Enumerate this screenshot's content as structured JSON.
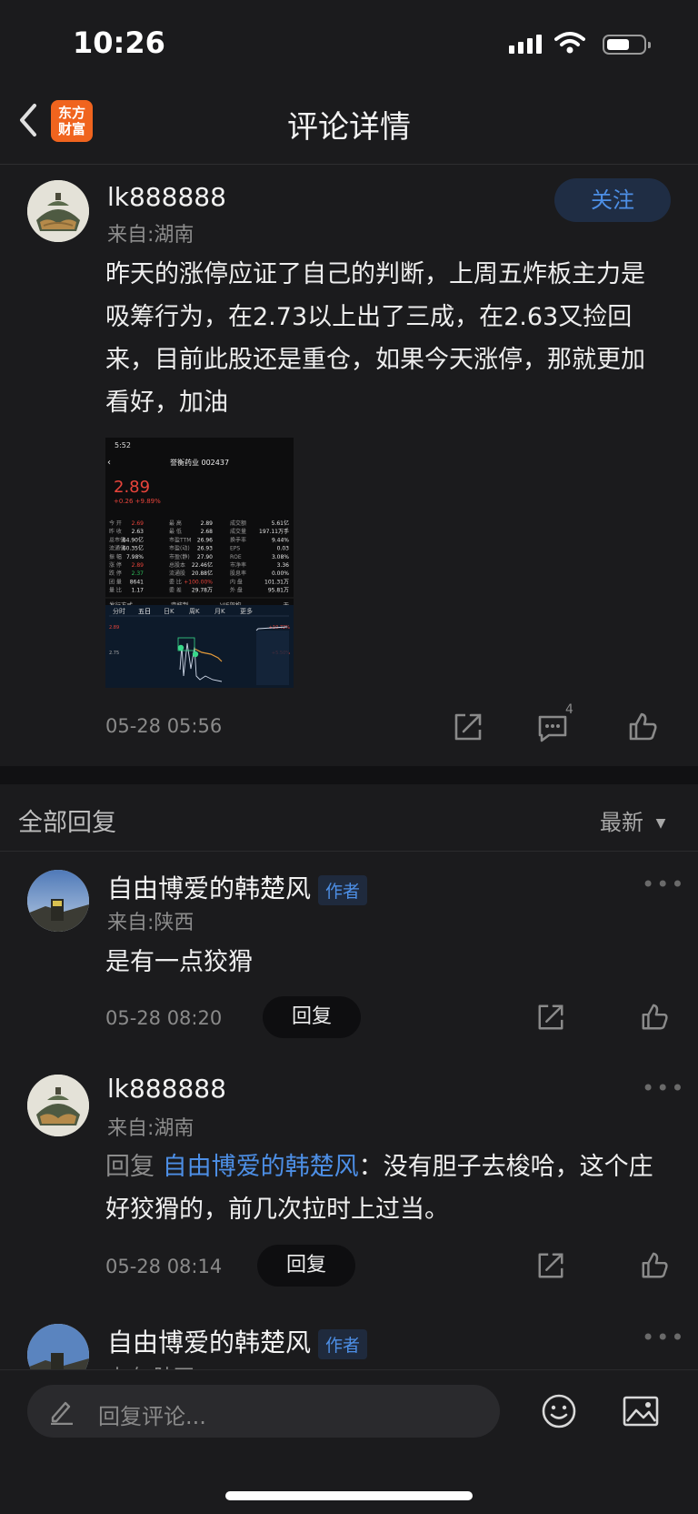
{
  "status": {
    "time": "10:26"
  },
  "header": {
    "title": "评论详情",
    "logo_line1": "东方",
    "logo_line2": "财富"
  },
  "post": {
    "username": "lk888888",
    "location": "来自:湖南",
    "follow_label": "关注",
    "text": "昨天的涨停应证了自己的判断，上周五炸板主力是吸筹行为，在2.73以上出了三成，在2.63又捡回来，目前此股还是重仓，如果今天涨停，那就更加看好，加油",
    "timestamp": "05-28 05:56",
    "comment_count": "4",
    "screenshot": {
      "time": "5:52",
      "stock_name": "誉衡药业 002437",
      "price": "2.89",
      "change": "+0.26 +9.89%",
      "rows": [
        [
          "今 开",
          "2.69",
          "最 高",
          "2.89",
          "成交额",
          "5.61亿"
        ],
        [
          "昨 收",
          "2.63",
          "最 低",
          "2.68",
          "成交量",
          "197.11万手"
        ],
        [
          "总市值",
          "64.90亿",
          "市盈TTM",
          "26.96",
          "换手率",
          "9.44%"
        ],
        [
          "流通值",
          "60.35亿",
          "市盈(动)",
          "26.93",
          "EPS",
          "0.03"
        ],
        [
          "振 幅",
          "7.98%",
          "市盈(静)",
          "27.90",
          "ROE",
          "3.08%"
        ],
        [
          "涨 停",
          "2.89",
          "总股本",
          "22.46亿",
          "市净率",
          "3.36"
        ],
        [
          "跌 停",
          "2.37",
          "流通股",
          "20.88亿",
          "股息率",
          "0.00%"
        ],
        [
          "团 量",
          "8641",
          "委 比",
          "+100.00%",
          "内 盘",
          "101.31万"
        ],
        [
          "量 比",
          "1.17",
          "委 差",
          "29.78万",
          "外 盘",
          "95.81万"
        ]
      ],
      "tabs": [
        "发行方式",
        "审核制",
        "VIE架构",
        "无"
      ],
      "chart_tabs": [
        "分时",
        "五日",
        "日K",
        "周K",
        "月K",
        "更多"
      ],
      "chart_label_top": "2.89",
      "chart_label_mid": "2.75",
      "chart_right_top": "+10.72%",
      "chart_right_mid": "+5.50%"
    }
  },
  "replies_section": {
    "title": "全部回复",
    "sort_label": "最新"
  },
  "replies": [
    {
      "username": "自由博爱的韩楚风",
      "badge": "作者",
      "location": "来自:陕西",
      "text": "是有一点狡猾",
      "timestamp": "05-28 08:20",
      "reply_label": "回复"
    },
    {
      "username": "lk888888",
      "location": "来自:湖南",
      "reply_prefix": "回复",
      "reply_to": "自由博爱的韩楚风",
      "text": "：没有胆子去梭哈，这个庄好狡猾的，前几次拉时上过当。",
      "timestamp": "05-28 08:14",
      "reply_label": "回复"
    },
    {
      "username": "自由博爱的韩楚风",
      "badge": "作者",
      "location": "来自:陕西"
    }
  ],
  "composer": {
    "placeholder": "回复评论..."
  },
  "colors": {
    "accent": "#4d8fe6",
    "brand": "#f0641e",
    "up": "#e8443b",
    "down": "#2dbd5a"
  }
}
